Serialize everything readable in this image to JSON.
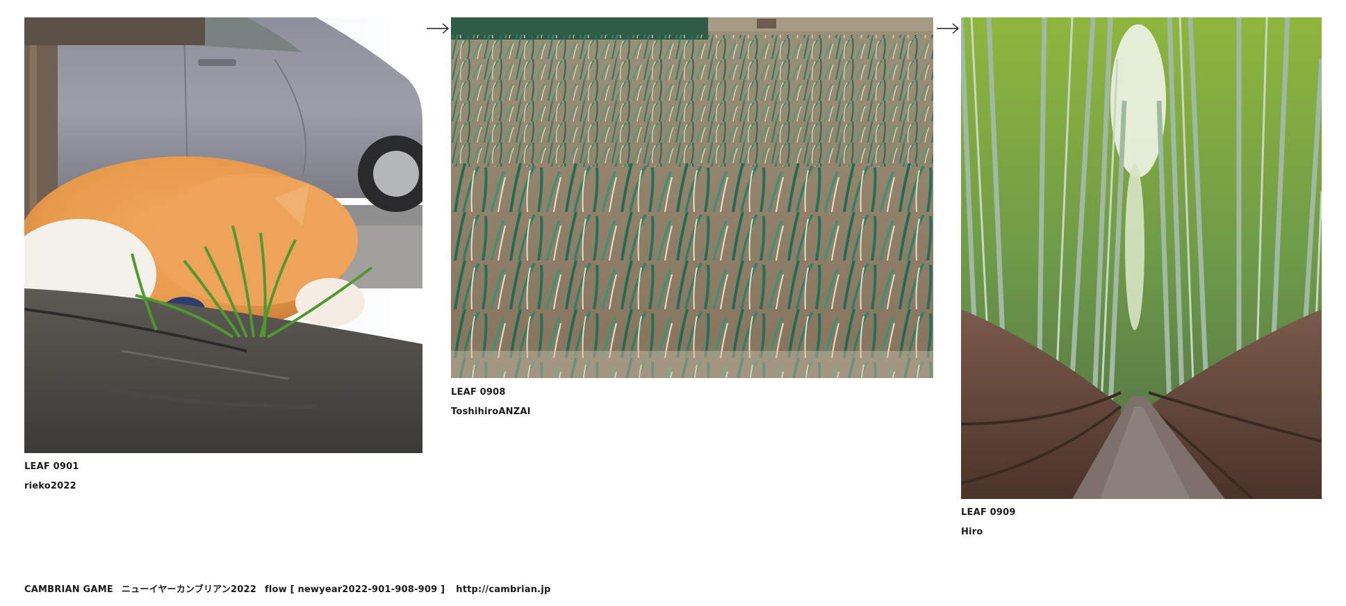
{
  "leaves": [
    {
      "code": "LEAF 0901",
      "author": "rieko2022",
      "image": "photo-cat-sleeping-in-grass"
    },
    {
      "code": "LEAF 0908",
      "author": "ToshihiroANZAI",
      "image": "photo-green-onion-field"
    },
    {
      "code": "LEAF 0909",
      "author": "Hiro",
      "image": "photo-bamboo-forest-path"
    }
  ],
  "footer": {
    "brand": "CAMBRIAN GAME",
    "game_name": "ニューイヤーカンブリアン2022",
    "flow": "flow [ newyear2022-901-908-909 ]",
    "url": "http://cambrian.jp"
  },
  "icons": {
    "connector": "right-arrow-icon"
  },
  "colors": {
    "text": "#1a1a1a",
    "background": "#ffffff"
  }
}
